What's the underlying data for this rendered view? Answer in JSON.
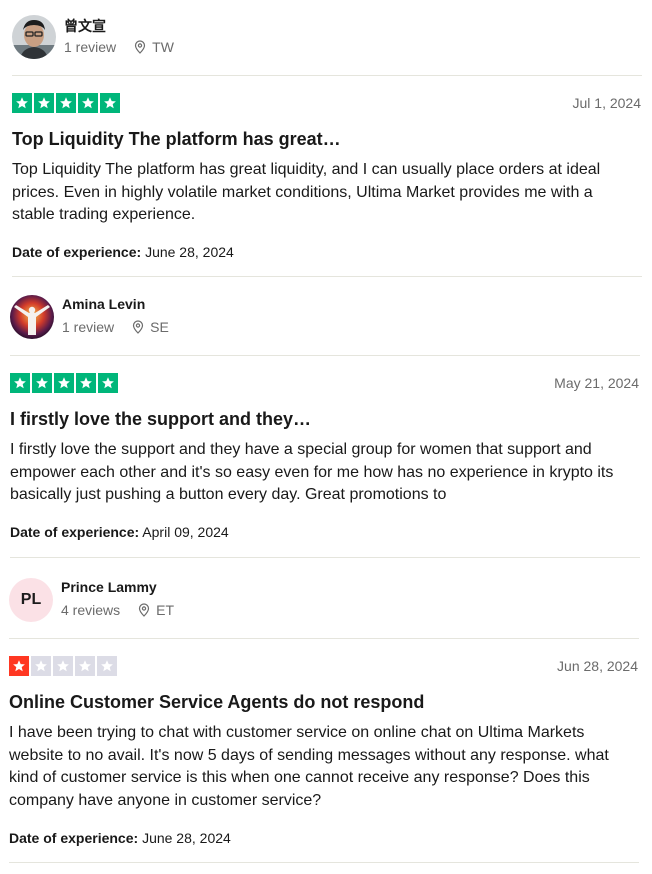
{
  "colors": {
    "star_green": "#00b67a",
    "star_red": "#ff3722",
    "star_empty": "#dcdce6",
    "initials_bg": "#fbe1e6",
    "divider": "#e5e5dd"
  },
  "reviews": [
    {
      "reviewer_name": "曾文宣",
      "review_count": "1 review",
      "country": "TW",
      "rating": 5,
      "date": "Jul 1, 2024",
      "title": "Top Liquidity The platform has great…",
      "body": "Top Liquidity The platform has great liquidity, and I can usually place orders at ideal prices. Even in highly volatile market conditions, Ultima Market provides me with a stable trading experience.",
      "experience_label": "Date of experience:",
      "experience_date": "June 28, 2024"
    },
    {
      "reviewer_name": "Amina Levin",
      "review_count": "1 review",
      "country": "SE",
      "rating": 5,
      "date": "May 21, 2024",
      "title": "I firstly love the support and they…",
      "body": "I firstly love the support and they have a special group for women that support and empower each other and it's so easy even for me how has no experience in krypto its basically just pushing a button every day. Great promotions to",
      "experience_label": "Date of experience:",
      "experience_date": "April 09, 2024"
    },
    {
      "reviewer_name": "Prince Lammy",
      "initials": "PL",
      "review_count": "4 reviews",
      "country": "ET",
      "rating": 1,
      "date": "Jun 28, 2024",
      "title": "Online Customer Service Agents do not respond",
      "body": "I have been trying to chat with customer service on online chat on Ultima Markets website to no avail. It's now 5 days of sending messages without any response. what kind of customer service is this when one cannot receive any response? Does this company have anyone in customer service?",
      "experience_label": "Date of experience:",
      "experience_date": "June 28, 2024"
    }
  ]
}
